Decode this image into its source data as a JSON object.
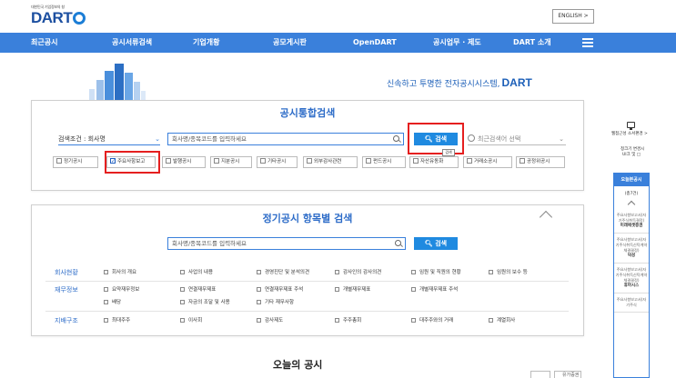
{
  "header": {
    "logo_small": "대한민국 기업정보의 창",
    "logo_text": "DART",
    "english_label": "ENGLISH  >"
  },
  "nav": {
    "items": [
      "최근공시",
      "공시서류검색",
      "기업개황",
      "공모게시판",
      "OpenDART",
      "공시업무 · 제도",
      "DART 소개"
    ],
    "menu_icon": "hamburger-icon"
  },
  "hero": {
    "tagline_text": "신속하고 투명한 전자공시시스템,",
    "tagline_brand": "DART"
  },
  "unified_search": {
    "title": "공시통합검색",
    "condition_label": "검색조건 : 회사명",
    "input_placeholder": "회사명/종목코드를 입력하세요",
    "search_button": "검색",
    "recent_placeholder": "최근검색어 선택",
    "tooltip": "검색",
    "checkboxes": [
      {
        "label": "정기공시",
        "checked": false
      },
      {
        "label": "주요사항보고",
        "checked": true
      },
      {
        "label": "발행공시",
        "checked": false
      },
      {
        "label": "지분공시",
        "checked": false
      },
      {
        "label": "기타공시",
        "checked": false
      },
      {
        "label": "외부감사관련",
        "checked": false
      },
      {
        "label": "펀드공시",
        "checked": false
      },
      {
        "label": "자산유동화",
        "checked": false
      },
      {
        "label": "거래소공시",
        "checked": false
      },
      {
        "label": "공정위공시",
        "checked": false
      }
    ]
  },
  "item_search": {
    "title": "정기공시 항목별 검색",
    "input_placeholder": "회사명/종목코드를 입력하세요",
    "search_button": "검색",
    "groups": [
      {
        "label": "회사현황",
        "options": [
          "회사의 개요",
          "사업의 내용",
          "경영진단 및 분석의견",
          "감사인의 감사의견",
          "임원 및 직원의 현황",
          "임원의 보수 등"
        ]
      },
      {
        "label": "재무정보",
        "options": [
          "요약재무정보",
          "연결재무제표",
          "연결재무제표 주석",
          "개별재무제표",
          "개별재무제표 주석",
          "배당",
          "자금의 조달 및 사용",
          "기타 재무사항"
        ]
      },
      {
        "label": "지배구조",
        "options": [
          "최대주주",
          "이사회",
          "감사제도",
          "주주총회",
          "대주주와의 거래",
          "계열회사"
        ]
      }
    ]
  },
  "today": {
    "title": "오늘의 공시",
    "ctrl_label": "유가증권"
  },
  "side": {
    "zoom_label": "웹접근성 소서편경 >",
    "history_label": "청크기 변경시",
    "history_label2": "UI크 및 □",
    "panel_title": "오늘본공시",
    "count": "(총7건)",
    "items": [
      {
        "type": "주요사항보고서(자기주식취득결정)",
        "company": "미래에셋증권"
      },
      {
        "type": "주요사항보고서(자기주식취득신탁계약체결결정)",
        "company": "덕성"
      },
      {
        "type": "주요사항보고서(자기주식취득신탁계약체결결정)",
        "company": "휴마시스"
      },
      {
        "type": "주요사항보고서(자기주식",
        "company": ""
      }
    ]
  },
  "colors": {
    "nav_bg": "#3a80db",
    "title_blue": "#2d6cc8",
    "button_blue": "#1f8ae0",
    "highlight_red": "#e51f1f"
  }
}
